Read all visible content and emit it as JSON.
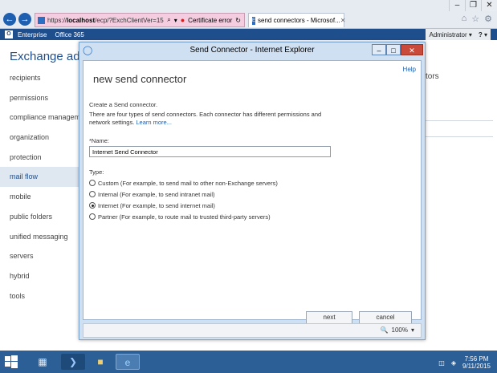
{
  "browser": {
    "url_prefix": "https://",
    "url_host": "localhost",
    "url_path": "/ecp/?ExchClientVer=15",
    "search_glyph": "⌕",
    "dropdown_glyph": "▾",
    "cert_error": "Certificate error",
    "refresh_glyph": "↻",
    "tab_title": "send connectors - Microsof...",
    "tab_close": "✕",
    "window_minimize": "–",
    "window_restore": "❐",
    "window_close": "✕",
    "back_glyph": "←",
    "forward_glyph": "→",
    "home_glyph": "⌂",
    "favorites_glyph": "☆",
    "settings_glyph": "⚙"
  },
  "o365": {
    "links": [
      "Enterprise",
      "Office 365"
    ],
    "admin_label": "Administrator",
    "admin_caret": "▾",
    "help_glyph": "?",
    "help_caret": "▾"
  },
  "eac": {
    "title": "Exchange admi",
    "nav_items": [
      "recipients",
      "permissions",
      "compliance management",
      "organization",
      "protection",
      "mail flow",
      "mobile",
      "public folders",
      "unified messaging",
      "servers",
      "hybrid",
      "tools"
    ],
    "active_item": "mail flow",
    "bg_text": "tors"
  },
  "modal": {
    "window_title": "Send Connector - Internet Explorer",
    "minimize": "–",
    "restore": "□",
    "close": "✕",
    "help_label": "Help",
    "form_title": "new send connector",
    "intro": "Create a Send connector.",
    "description": "There are four types of send connectors. Each connector has different permissions and network settings.",
    "learn_more": "Learn more...",
    "name_label": "*Name:",
    "name_value": "Internet Send Connector",
    "type_label": "Type:",
    "type_options": [
      {
        "label": "Custom (For example, to send mail to other non-Exchange servers)",
        "checked": false
      },
      {
        "label": "Internal (For example, to send intranet mail)",
        "checked": false
      },
      {
        "label": "Internet (For example, to send internet mail)",
        "checked": true
      },
      {
        "label": "Partner (For example, to route mail to trusted third-party servers)",
        "checked": false
      }
    ],
    "next_label": "next",
    "cancel_label": "cancel",
    "zoom_level": "100%",
    "zoom_caret": "▾"
  },
  "taskbar": {
    "time": "7:56 PM",
    "date": "9/11/2015"
  },
  "colors": {
    "accent": "#1f4e8c",
    "taskbar": "#2c5f96",
    "modal_frame": "#cfe0f3"
  }
}
